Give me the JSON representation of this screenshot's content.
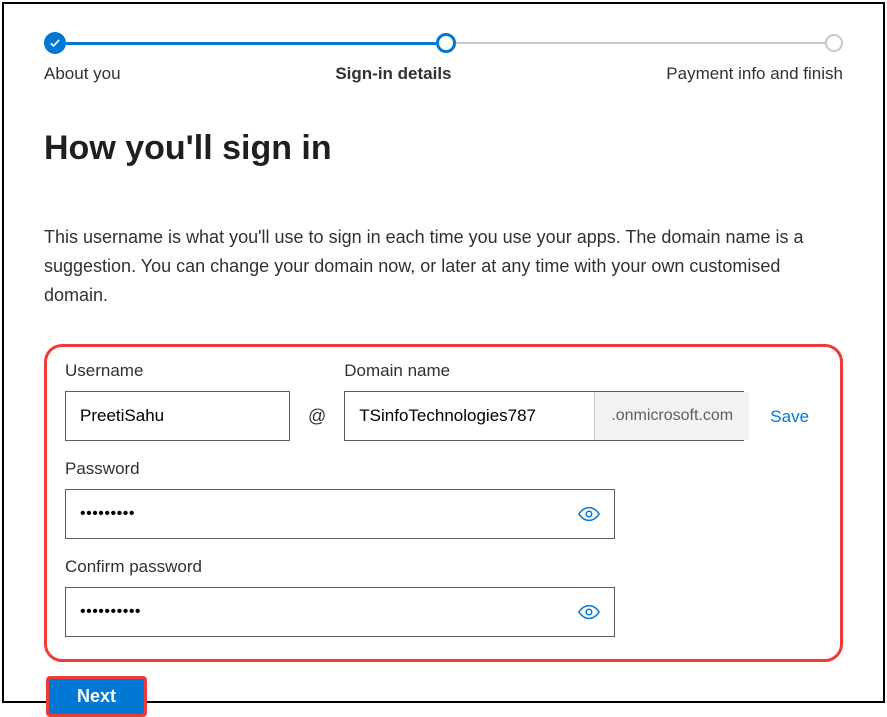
{
  "stepper": {
    "step1": "About you",
    "step2": "Sign-in details",
    "step3": "Payment info and finish"
  },
  "heading": "How you'll sign in",
  "description": "This username is what you'll use to sign in each time you use your apps. The domain name is a suggestion. You can change your domain now, or later at any time with your own customised domain.",
  "form": {
    "username_label": "Username",
    "username_value": "PreetiSahu",
    "at": "@",
    "domain_label": "Domain name",
    "domain_value": "TSinfoTechnologies787",
    "domain_suffix": ".onmicrosoft.com",
    "save": "Save",
    "password_label": "Password",
    "password_value": "•••••••••",
    "confirm_label": "Confirm password",
    "confirm_value": "••••••••••"
  },
  "next": "Next"
}
